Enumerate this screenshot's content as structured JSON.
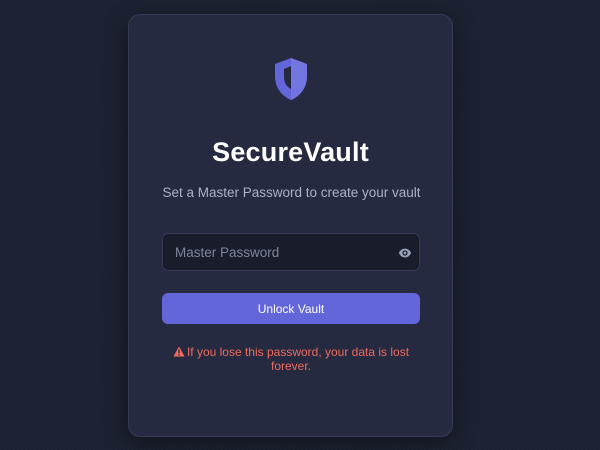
{
  "app": {
    "title": "SecureVault",
    "subtitle": "Set a Master Password to create your vault",
    "icon": "shield-icon"
  },
  "form": {
    "password_placeholder": "Master Password",
    "password_value": "",
    "toggle_icon": "eye-icon",
    "submit_label": "Unlock Vault"
  },
  "warning": {
    "icon": "warning-icon",
    "text": "If you lose this password, your data is lost forever."
  },
  "colors": {
    "background": "#1b2130",
    "card": "#252a40",
    "accent": "#6366d9",
    "warning": "#ee6a5c"
  }
}
